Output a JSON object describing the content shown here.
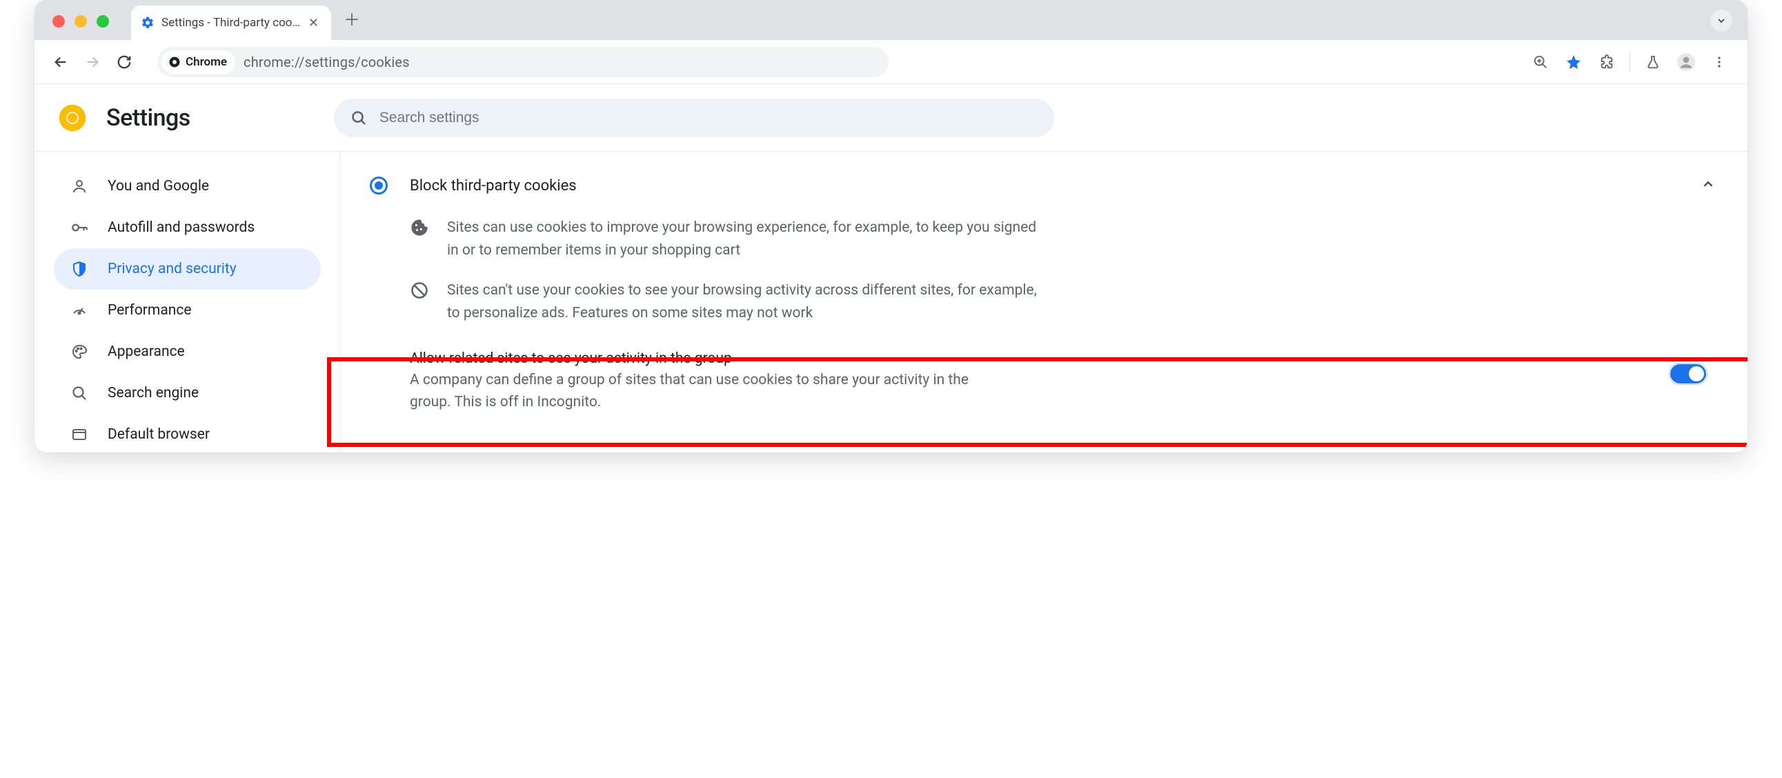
{
  "window": {
    "tab_title": "Settings - Third-party cookies"
  },
  "toolbar": {
    "chrome_chip": "Chrome",
    "url": "chrome://settings/cookies"
  },
  "header": {
    "title": "Settings",
    "search_placeholder": "Search settings"
  },
  "sidebar": {
    "items": [
      {
        "label": "You and Google"
      },
      {
        "label": "Autofill and passwords"
      },
      {
        "label": "Privacy and security"
      },
      {
        "label": "Performance"
      },
      {
        "label": "Appearance"
      },
      {
        "label": "Search engine"
      },
      {
        "label": "Default browser"
      }
    ]
  },
  "main": {
    "radio_label": "Block third-party cookies",
    "desc1": "Sites can use cookies to improve your browsing experience, for example, to keep you signed in or to remember items in your shopping cart",
    "desc2": "Sites can't use your cookies to see your browsing activity across different sites, for example, to personalize ads. Features on some sites may not work",
    "toggle_title": "Allow related sites to see your activity in the group",
    "toggle_sub": "A company can define a group of sites that can use cookies to share your activity in the group. This is off in Incognito.",
    "toggle_on": true
  }
}
